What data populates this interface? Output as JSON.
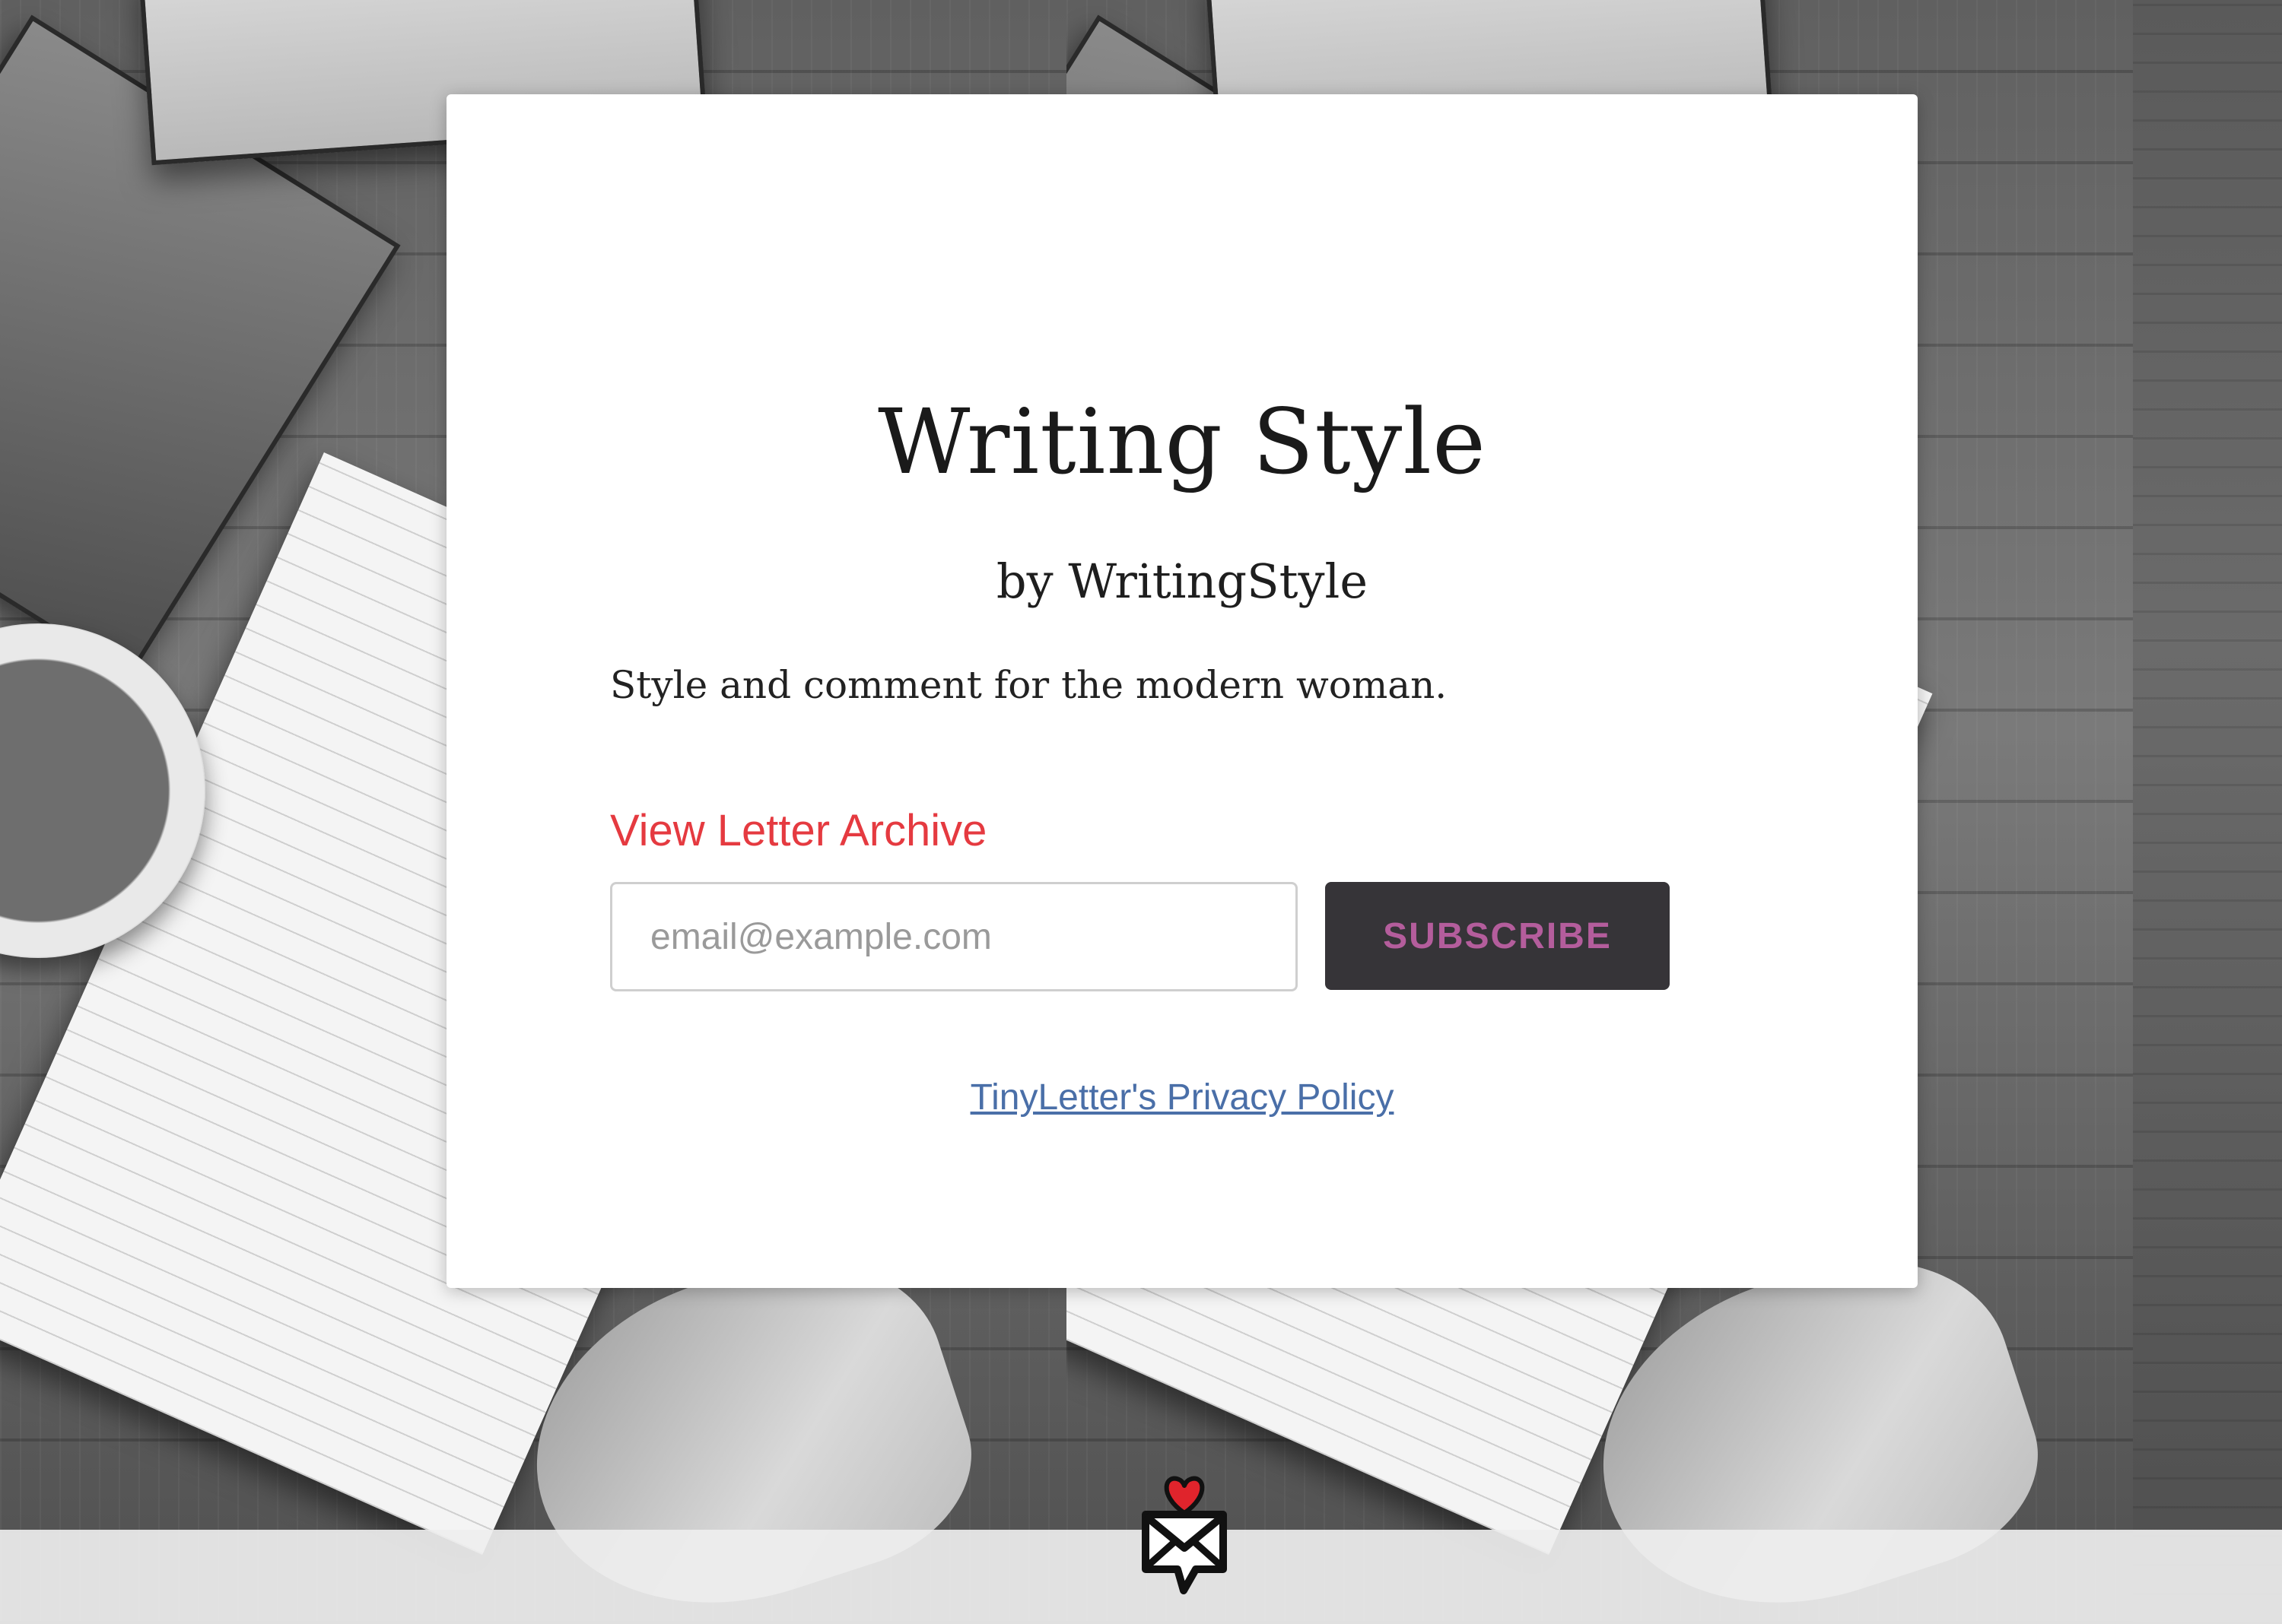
{
  "newsletter": {
    "title": "Writing Style",
    "byline": "by WritingStyle",
    "description": "Style and comment for the modern woman."
  },
  "archive": {
    "link_label": "View Letter Archive"
  },
  "subscribe_form": {
    "email_placeholder": "email@example.com",
    "email_value": "",
    "button_label": "SUBSCRIBE"
  },
  "footer": {
    "privacy_label": "TinyLetter's Privacy Policy",
    "logo_icon": "tinyletter-heart-envelope-icon"
  },
  "background": {
    "description_icon": "newspapers-coffee-notebook-photo"
  },
  "colors": {
    "link_accent": "#e53a40",
    "button_bg": "#363438",
    "button_text": "#b45d9c",
    "privacy_link": "#4a6fa8",
    "logo_heart": "#e0242c"
  }
}
